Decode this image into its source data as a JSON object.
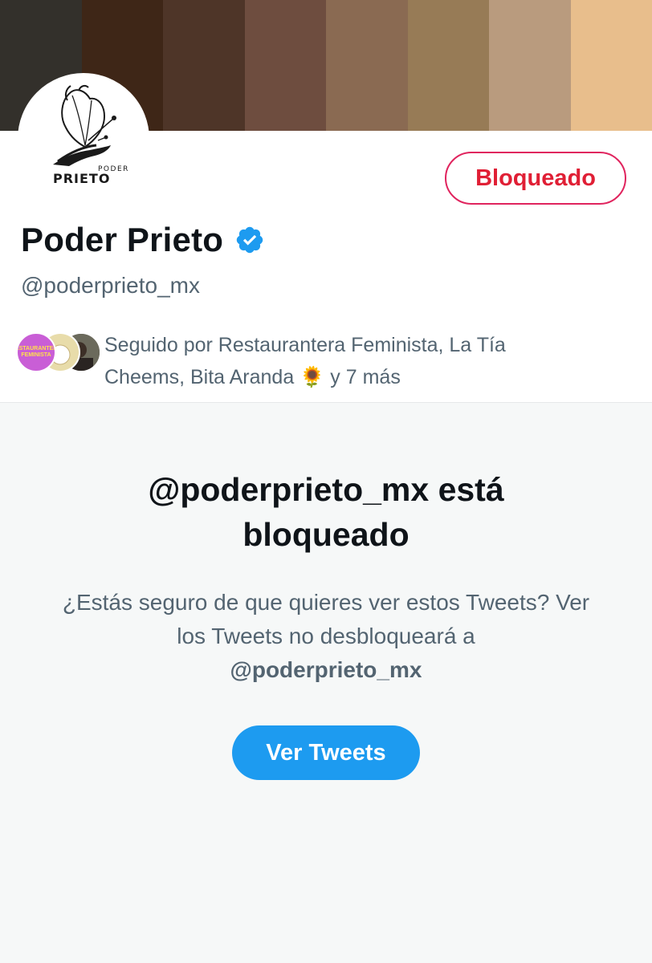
{
  "banner": {
    "colors": [
      "#33302b",
      "#3e2617",
      "#4e3528",
      "#6e4d3f",
      "#8a6a52",
      "#977b56",
      "#b99b7e",
      "#e8be8c"
    ]
  },
  "profile": {
    "avatar_logo_top": "PODER",
    "avatar_logo_bottom": "PRIETO",
    "block_button_label": "Bloqueado",
    "display_name": "Poder Prieto",
    "verified_icon": "verified-badge-icon",
    "handle": "@poderprieto_mx",
    "followed_by_prefix": "Seguido por Restaurantera Feminista, La Tía Cheems, Bita Aranda",
    "followed_by_emoji": "🌻",
    "followed_by_suffix": "y 7 más",
    "follower_avatar_1_text": "RESTAURANTERA FEMINISTA"
  },
  "blocked": {
    "title": "@poderprieto_mx está bloqueado",
    "description": "¿Estás seguro de que quieres ver estos Tweets? Ver los Tweets no desbloqueará a",
    "description_handle": "@poderprieto_mx",
    "view_button_label": "Ver Tweets"
  },
  "colors": {
    "accent": "#1d9bf0",
    "blocked_red": "#e01f35",
    "text_primary": "#0f1419",
    "text_secondary": "#536471"
  }
}
